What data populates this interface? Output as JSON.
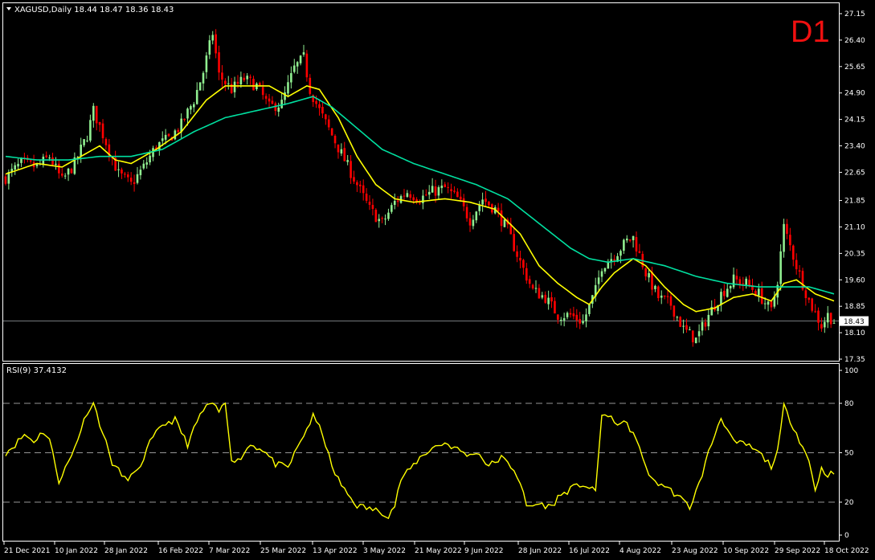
{
  "window": {
    "symbol_line": "XAGUSD,Daily  18.44 18.47 18.36 18.43",
    "timeframe_badge": "D1",
    "current_price": "18.43"
  },
  "colors": {
    "background": "#000000",
    "frame": "#ffffff",
    "bull_candle": "#90ee90",
    "bear_candle": "#ff0000",
    "ma_fast": "#ffff00",
    "ma_slow": "#00e0a0",
    "rsi": "#ffff00",
    "badge": "#f01010"
  },
  "chart_data": [
    {
      "type": "candlestick",
      "title": "XAGUSD,Daily",
      "ohlc_readout": "18.44 18.47 18.36 18.43",
      "ylim": [
        17.35,
        27.15
      ],
      "y_ticks": [
        "27.15",
        "26.40",
        "25.65",
        "24.90",
        "24.15",
        "23.40",
        "22.65",
        "21.85",
        "21.10",
        "20.35",
        "19.60",
        "18.85",
        "18.10",
        "17.35"
      ],
      "x_ticks": [
        "21 Dec 2021",
        "10 Jan 2022",
        "28 Jan 2022",
        "16 Feb 2022",
        "7 Mar 2022",
        "25 Mar 2022",
        "13 Apr 2022",
        "3 May 2022",
        "21 May 2022",
        "9 Jun 2022",
        "28 Jun 2022",
        "16 Jul 2022",
        "4 Aug 2022",
        "23 Aug 2022",
        "10 Sep 2022",
        "29 Sep 2022",
        "18 Oct 2022"
      ],
      "current_price": 18.43,
      "close_path": [
        [
          0,
          22.5
        ],
        [
          5,
          22.9
        ],
        [
          10,
          22.8
        ],
        [
          14,
          23.1
        ],
        [
          18,
          22.4
        ],
        [
          22,
          22.9
        ],
        [
          26,
          23.7
        ],
        [
          28,
          24.4
        ],
        [
          32,
          23.5
        ],
        [
          36,
          22.6
        ],
        [
          40,
          22.3
        ],
        [
          44,
          22.8
        ],
        [
          48,
          23.4
        ],
        [
          52,
          23.6
        ],
        [
          56,
          24.0
        ],
        [
          60,
          24.7
        ],
        [
          63,
          25.5
        ],
        [
          66,
          26.6
        ],
        [
          68,
          25.4
        ],
        [
          72,
          25.0
        ],
        [
          76,
          25.3
        ],
        [
          80,
          25.1
        ],
        [
          84,
          24.5
        ],
        [
          88,
          24.6
        ],
        [
          92,
          25.6
        ],
        [
          95,
          25.9
        ],
        [
          97,
          25.0
        ],
        [
          100,
          24.4
        ],
        [
          104,
          23.7
        ],
        [
          108,
          23.0
        ],
        [
          112,
          22.3
        ],
        [
          116,
          21.6
        ],
        [
          120,
          21.2
        ],
        [
          124,
          21.8
        ],
        [
          128,
          22.1
        ],
        [
          132,
          21.9
        ],
        [
          136,
          22.1
        ],
        [
          140,
          22.2
        ],
        [
          144,
          21.9
        ],
        [
          148,
          21.3
        ],
        [
          152,
          21.9
        ],
        [
          156,
          21.6
        ],
        [
          160,
          21.0
        ],
        [
          164,
          20.1
        ],
        [
          168,
          19.3
        ],
        [
          172,
          19.1
        ],
        [
          176,
          18.6
        ],
        [
          180,
          18.6
        ],
        [
          184,
          18.4
        ],
        [
          188,
          19.3
        ],
        [
          190,
          20.0
        ],
        [
          194,
          20.3
        ],
        [
          198,
          20.7
        ],
        [
          200,
          20.8
        ],
        [
          204,
          19.8
        ],
        [
          208,
          19.1
        ],
        [
          212,
          18.9
        ],
        [
          216,
          18.2
        ],
        [
          220,
          17.9
        ],
        [
          224,
          18.6
        ],
        [
          228,
          19.2
        ],
        [
          232,
          19.6
        ],
        [
          236,
          19.5
        ],
        [
          240,
          19.2
        ],
        [
          244,
          18.7
        ],
        [
          246,
          19.6
        ],
        [
          248,
          21.1
        ],
        [
          252,
          20.0
        ],
        [
          256,
          19.0
        ],
        [
          260,
          18.3
        ],
        [
          262,
          18.6
        ],
        [
          264,
          18.43
        ]
      ],
      "series": [
        {
          "kind": "ma_fast",
          "points": [
            [
              0,
              22.6
            ],
            [
              10,
              22.9
            ],
            [
              18,
              22.8
            ],
            [
              22,
              23.0
            ],
            [
              30,
              23.4
            ],
            [
              35,
              23.0
            ],
            [
              40,
              22.9
            ],
            [
              48,
              23.3
            ],
            [
              56,
              23.8
            ],
            [
              64,
              24.7
            ],
            [
              70,
              25.1
            ],
            [
              78,
              25.1
            ],
            [
              84,
              25.1
            ],
            [
              90,
              24.8
            ],
            [
              96,
              25.1
            ],
            [
              100,
              25.0
            ],
            [
              106,
              24.2
            ],
            [
              112,
              23.1
            ],
            [
              118,
              22.3
            ],
            [
              124,
              21.9
            ],
            [
              130,
              21.8
            ],
            [
              140,
              21.9
            ],
            [
              148,
              21.8
            ],
            [
              156,
              21.6
            ],
            [
              164,
              20.9
            ],
            [
              170,
              20.0
            ],
            [
              176,
              19.5
            ],
            [
              182,
              19.1
            ],
            [
              186,
              18.9
            ],
            [
              190,
              19.4
            ],
            [
              194,
              19.8
            ],
            [
              200,
              20.2
            ],
            [
              204,
              20.0
            ],
            [
              210,
              19.4
            ],
            [
              216,
              18.9
            ],
            [
              220,
              18.7
            ],
            [
              226,
              18.8
            ],
            [
              232,
              19.1
            ],
            [
              238,
              19.2
            ],
            [
              244,
              19.0
            ],
            [
              248,
              19.5
            ],
            [
              252,
              19.6
            ],
            [
              258,
              19.2
            ],
            [
              264,
              19.0
            ]
          ]
        },
        {
          "kind": "ma_slow",
          "points": [
            [
              0,
              23.1
            ],
            [
              10,
              23.0
            ],
            [
              20,
              23.0
            ],
            [
              30,
              23.1
            ],
            [
              40,
              23.1
            ],
            [
              50,
              23.3
            ],
            [
              60,
              23.8
            ],
            [
              70,
              24.2
            ],
            [
              80,
              24.4
            ],
            [
              90,
              24.6
            ],
            [
              98,
              24.8
            ],
            [
              104,
              24.5
            ],
            [
              112,
              23.9
            ],
            [
              120,
              23.3
            ],
            [
              130,
              22.9
            ],
            [
              140,
              22.6
            ],
            [
              150,
              22.3
            ],
            [
              160,
              21.9
            ],
            [
              170,
              21.2
            ],
            [
              180,
              20.5
            ],
            [
              186,
              20.2
            ],
            [
              192,
              20.1
            ],
            [
              200,
              20.2
            ],
            [
              210,
              20.0
            ],
            [
              220,
              19.7
            ],
            [
              230,
              19.5
            ],
            [
              240,
              19.4
            ],
            [
              250,
              19.4
            ],
            [
              256,
              19.4
            ],
            [
              264,
              19.2
            ]
          ]
        }
      ]
    },
    {
      "type": "line",
      "title": "RSI(9) 37.4132",
      "name": "RSI(9)",
      "last_value": 37.4132,
      "ylim": [
        0,
        100
      ],
      "y_ticks": [
        "100",
        "80",
        "50",
        "20",
        "0"
      ],
      "levels": [
        80,
        50,
        20
      ],
      "values": [
        [
          0,
          50
        ],
        [
          3,
          55
        ],
        [
          6,
          61
        ],
        [
          9,
          57
        ],
        [
          12,
          63
        ],
        [
          14,
          58
        ],
        [
          17,
          33
        ],
        [
          21,
          48
        ],
        [
          26,
          75
        ],
        [
          28,
          80
        ],
        [
          31,
          62
        ],
        [
          34,
          44
        ],
        [
          38,
          34
        ],
        [
          42,
          38
        ],
        [
          46,
          56
        ],
        [
          50,
          67
        ],
        [
          54,
          70
        ],
        [
          58,
          55
        ],
        [
          62,
          73
        ],
        [
          65,
          80
        ],
        [
          68,
          75
        ],
        [
          70,
          80
        ],
        [
          72,
          47
        ],
        [
          74,
          45
        ],
        [
          78,
          55
        ],
        [
          82,
          52
        ],
        [
          86,
          43
        ],
        [
          90,
          41
        ],
        [
          94,
          57
        ],
        [
          98,
          72
        ],
        [
          101,
          62
        ],
        [
          104,
          41
        ],
        [
          108,
          27
        ],
        [
          112,
          18
        ],
        [
          116,
          16
        ],
        [
          120,
          14
        ],
        [
          122,
          12
        ],
        [
          124,
          18
        ],
        [
          126,
          34
        ],
        [
          128,
          38
        ],
        [
          132,
          47
        ],
        [
          136,
          53
        ],
        [
          140,
          56
        ],
        [
          144,
          52
        ],
        [
          148,
          48
        ],
        [
          150,
          51
        ],
        [
          154,
          42
        ],
        [
          158,
          47
        ],
        [
          162,
          40
        ],
        [
          164,
          32
        ],
        [
          166,
          17
        ],
        [
          170,
          19
        ],
        [
          174,
          17
        ],
        [
          176,
          23
        ],
        [
          180,
          28
        ],
        [
          184,
          31
        ],
        [
          188,
          26
        ],
        [
          190,
          74
        ],
        [
          194,
          69
        ],
        [
          198,
          67
        ],
        [
          200,
          62
        ],
        [
          203,
          47
        ],
        [
          206,
          33
        ],
        [
          210,
          30
        ],
        [
          214,
          24
        ],
        [
          218,
          17
        ],
        [
          221,
          31
        ],
        [
          224,
          50
        ],
        [
          228,
          72
        ],
        [
          232,
          56
        ],
        [
          236,
          55
        ],
        [
          240,
          50
        ],
        [
          244,
          42
        ],
        [
          246,
          50
        ],
        [
          248,
          78
        ],
        [
          252,
          62
        ],
        [
          256,
          45
        ],
        [
          258,
          28
        ],
        [
          260,
          40
        ],
        [
          262,
          37
        ],
        [
          264,
          37.4
        ]
      ]
    }
  ]
}
